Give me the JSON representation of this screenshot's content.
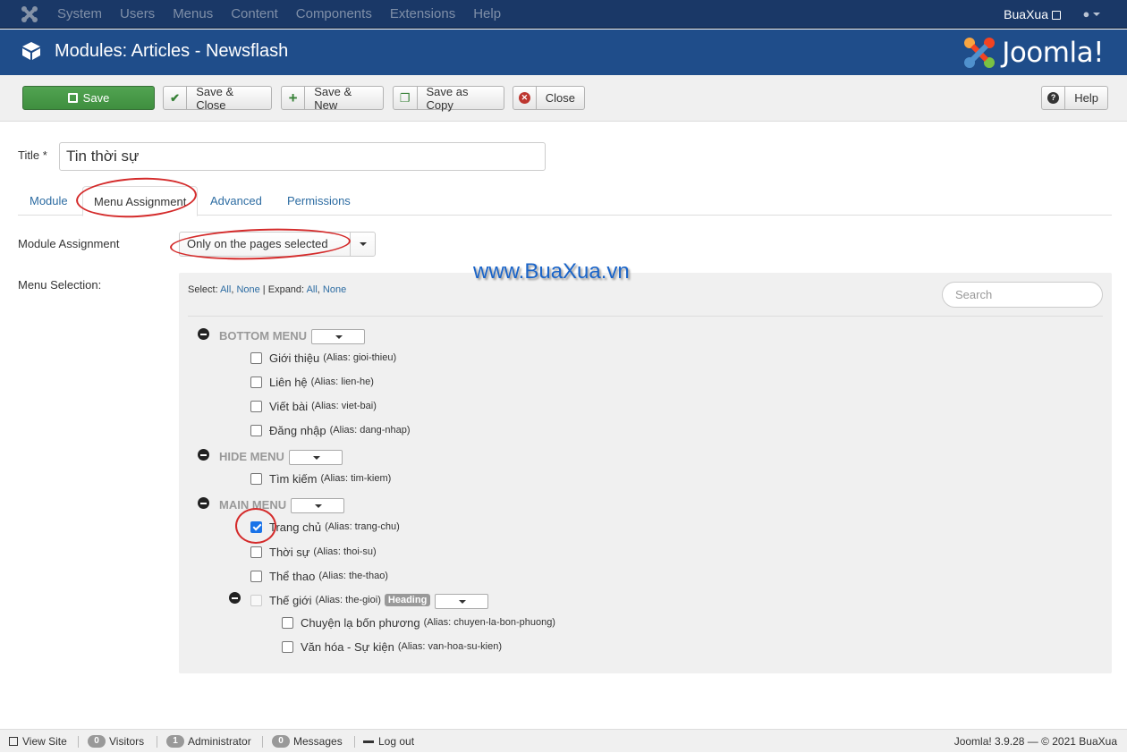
{
  "topnav": {
    "menu": [
      "System",
      "Users",
      "Menus",
      "Content",
      "Components",
      "Extensions",
      "Help"
    ],
    "site_name": "BuaXua"
  },
  "header": {
    "title": "Modules: Articles - Newsflash",
    "brand": "Joomla!"
  },
  "toolbar": {
    "save": "Save",
    "save_close": "Save & Close",
    "save_new": "Save & New",
    "save_copy": "Save as Copy",
    "close": "Close",
    "help": "Help"
  },
  "form": {
    "title_label": "Title *",
    "title_value": "Tin thời sự",
    "tabs": [
      "Module",
      "Menu Assignment",
      "Advanced",
      "Permissions"
    ],
    "active_tab": "Menu Assignment",
    "module_assignment_label": "Module Assignment",
    "module_assignment_value": "Only on the pages selected",
    "menu_selection_label": "Menu Selection:"
  },
  "menu_panel": {
    "select_label": "Select:",
    "select_all": "All",
    "select_none": "None",
    "expand_label": "Expand:",
    "expand_all": "All",
    "expand_none": "None",
    "search_placeholder": "Search",
    "groups": [
      {
        "name": "BOTTOM MENU",
        "items": [
          {
            "label": "Giới thiệu",
            "alias": "(Alias: gioi-thieu)",
            "checked": false
          },
          {
            "label": "Liên hệ",
            "alias": "(Alias: lien-he)",
            "checked": false
          },
          {
            "label": "Viết bài",
            "alias": "(Alias: viet-bai)",
            "checked": false
          },
          {
            "label": "Đăng nhập",
            "alias": "(Alias: dang-nhap)",
            "checked": false
          }
        ]
      },
      {
        "name": "HIDE MENU",
        "items": [
          {
            "label": "Tìm kiếm",
            "alias": "(Alias: tim-kiem)",
            "checked": false
          }
        ]
      },
      {
        "name": "MAIN MENU",
        "items": [
          {
            "label": "Trang chủ",
            "alias": "(Alias: trang-chu)",
            "checked": true
          },
          {
            "label": "Thời sự",
            "alias": "(Alias: thoi-su)",
            "checked": false
          },
          {
            "label": "Thể thao",
            "alias": "(Alias: the-thao)",
            "checked": false
          },
          {
            "label": "Thế giới",
            "alias": "(Alias: the-gioi)",
            "checked": false,
            "badge": "Heading"
          },
          {
            "label": "Chuyện lạ bốn phương",
            "alias": "(Alias: chuyen-la-bon-phuong)",
            "checked": false
          },
          {
            "label": "Văn hóa - Sự kiện",
            "alias": "(Alias: van-hoa-su-kien)",
            "checked": false
          }
        ]
      }
    ]
  },
  "watermark": "www.BuaXua.vn",
  "statusbar": {
    "view_site": "View Site",
    "visitors_count": "0",
    "visitors": "Visitors",
    "admin_count": "1",
    "admin": "Administrator",
    "messages_count": "0",
    "messages": "Messages",
    "logout": "Log out",
    "version": "Joomla! 3.9.28 — © 2021 BuaXua"
  },
  "colors": {
    "topnav": "#1a3867",
    "header": "#1f4d8a",
    "save_green": "#46a046",
    "link": "#2d6ca2",
    "annotation": "#d42b2b"
  }
}
